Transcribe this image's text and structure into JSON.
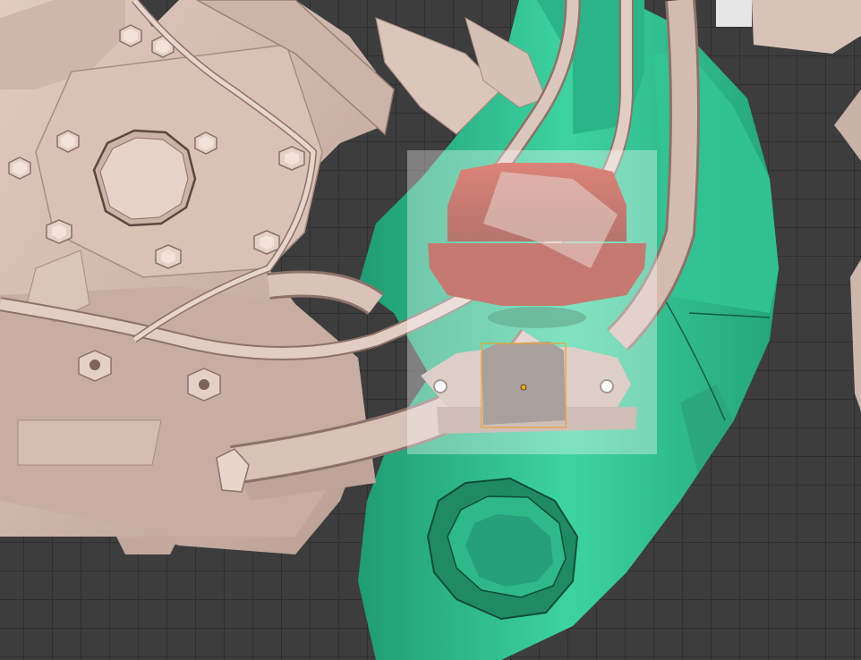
{
  "viewport": {
    "background_color": "#3d3d3d",
    "grid_color": "#2f2f2f",
    "selection_outline_color": "#f0a030",
    "origin_dot_color": "#f5a623"
  },
  "scene": {
    "engine_color": "#d6bdb2",
    "engine_shadow_color": "#a88c82",
    "exhaust_pipe_color": "#2fb88a",
    "exhaust_pipe_dark_color": "#1f8a64",
    "wastegate_valve_color": "#c0392b",
    "icons": [
      "hex-bolt-icon",
      "pipe-opening-icon",
      "wastegate-valve-icon",
      "object-origin-icon"
    ]
  }
}
